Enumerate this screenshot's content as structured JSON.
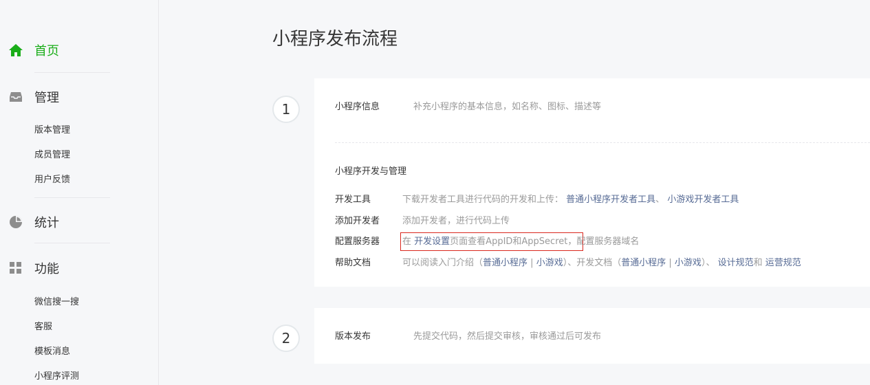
{
  "sidebar": {
    "home": {
      "label": "首页",
      "icon": "home-icon"
    },
    "manage": {
      "label": "管理",
      "icon": "inbox-icon",
      "items": [
        "版本管理",
        "成员管理",
        "用户反馈"
      ]
    },
    "stats": {
      "label": "统计",
      "icon": "pie-chart-icon"
    },
    "features": {
      "label": "功能",
      "icon": "grid-icon",
      "items": [
        "微信搜一搜",
        "客服",
        "模板消息",
        "小程序评测"
      ]
    },
    "active_color": "#1aad19"
  },
  "main": {
    "title": "小程序发布流程",
    "step1": {
      "number": "1",
      "info": {
        "label": "小程序信息",
        "desc": "补充小程序的基本信息，如名称、图标、描述等"
      },
      "dev_section_title": "小程序开发与管理",
      "dev_tools": {
        "label": "开发工具",
        "desc": "下载开发者工具进行代码的开发和上传：",
        "link1": "普通小程序开发者工具",
        "sep": "、",
        "link2": "小游戏开发者工具"
      },
      "add_dev": {
        "label": "添加开发者",
        "desc": "添加开发者，进行代码上传"
      },
      "server": {
        "label": "配置服务器",
        "pre": "在",
        "link": "开发设置",
        "mid": "页面查看AppID和AppSecret，",
        "post": "配置服务器域名"
      },
      "help": {
        "label": "帮助文档",
        "t1": "可以阅读入门介绍（",
        "l1": "普通小程序",
        "bar1": "|",
        "l2": "小游戏",
        "t2": "）、开发文档（",
        "l3": "普通小程序",
        "bar2": "|",
        "l4": "小游戏",
        "t3": "）、",
        "l5": "设计规范",
        "t4": "和",
        "l6": "运营规范"
      }
    },
    "step2": {
      "number": "2",
      "label": "版本发布",
      "desc": "先提交代码，然后提交审核，审核通过后可发布"
    },
    "colors": {
      "link": "#576b95",
      "highlight_border": "#d9261c"
    }
  }
}
